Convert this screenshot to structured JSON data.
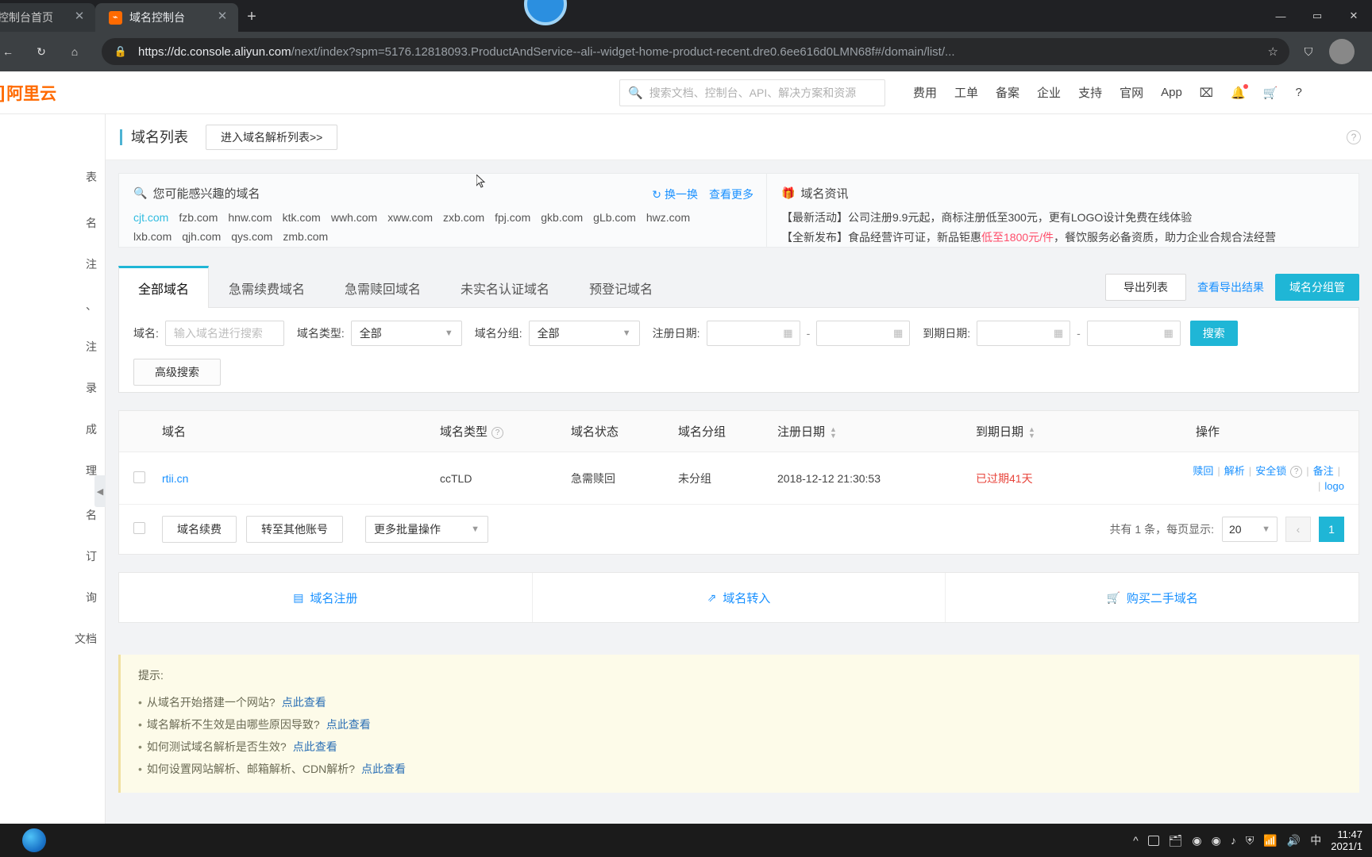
{
  "browser": {
    "tabs": [
      {
        "title": "云控制台首页",
        "favicon": "aliyun-icon",
        "active": false
      },
      {
        "title": "域名控制台",
        "favicon": "aliyun-icon",
        "active": true
      }
    ],
    "newtab_label": "+",
    "window_controls": [
      "—",
      "▭",
      "✕"
    ],
    "reload_icon": "↻",
    "home_icon": "⌂",
    "lock_icon": "🔒",
    "url_scheme": "https://",
    "url_host": "dc.console.aliyun.com",
    "url_path": "/next/index?spm=5176.12818093.ProductAndService--ali--widget-home-product-recent.dre0.6ee616d0LMN68f#/domain/list/...",
    "star_icon": "☆",
    "collections_icon": "⛉"
  },
  "aliyun_header": {
    "logo_text": "阿里云",
    "search_placeholder": "搜索文档、控制台、API、解决方案和资源",
    "nav": [
      "费用",
      "工单",
      "备案",
      "企业",
      "支持",
      "官网",
      "App"
    ],
    "icons": [
      "terminal-icon",
      "bell-icon",
      "cart-icon",
      "help-icon"
    ]
  },
  "left_rail": {
    "items": [
      "表",
      "名",
      "注",
      "、",
      "注",
      "录",
      "成",
      "理",
      "名",
      "订",
      "询",
      "文档"
    ]
  },
  "panel": {
    "title": "域名列表",
    "enter_resolution_button": "进入域名解析列表>>",
    "help_icon": "?"
  },
  "promo": {
    "suggest_title": "您可能感兴趣的域名",
    "suggest_icon": "search-sparkle-icon",
    "refresh_label": "换一换",
    "more_label": "查看更多",
    "domains_line1": [
      "cjt.com",
      "fzb.com",
      "hnw.com",
      "ktk.com",
      "wwh.com",
      "xww.com",
      "zxb.com",
      "fpj.com",
      "gkb.com",
      "gLb.com",
      "hwz.com"
    ],
    "domains_line2": [
      "lxb.com",
      "qjh.com",
      "qys.com",
      "zmb.com"
    ],
    "news_title": "域名资讯",
    "news_icon": "gift-icon",
    "news1_prefix": "【最新活动】公司注册9.9元起，商标注册低至300元，更有LOGO设计免费在线体验",
    "news2_a": "【全新发布】食品经营许可证，新品钜惠",
    "news2_hl": "低至1800元/件",
    "news2_b": "，餐饮服务必备资质，助力企业合规合法经营"
  },
  "tabs": [
    {
      "label": "全部域名",
      "active": true
    },
    {
      "label": "急需续费域名",
      "active": false
    },
    {
      "label": "急需赎回域名",
      "active": false
    },
    {
      "label": "未实名认证域名",
      "active": false
    },
    {
      "label": "预登记域名",
      "active": false
    }
  ],
  "tabs_right": {
    "export_button": "导出列表",
    "view_export_link": "查看导出结果",
    "group_button": "域名分组管"
  },
  "filters": {
    "domain_label": "域名:",
    "domain_placeholder": "输入域名进行搜索",
    "type_label": "域名类型:",
    "type_value": "全部",
    "group_label": "域名分组:",
    "group_value": "全部",
    "reg_date_label": "注册日期:",
    "reg_date_from": "",
    "reg_date_to": "",
    "exp_date_label": "到期日期:",
    "exp_date_from": "",
    "exp_date_to": "",
    "date_separator": "-",
    "calendar_icon": "📅",
    "search_button": "搜索",
    "advanced_button": "高级搜索"
  },
  "table": {
    "headers": {
      "domain": "域名",
      "type": "域名类型",
      "type_help": "?",
      "status": "域名状态",
      "group": "域名分组",
      "reg_date": "注册日期",
      "exp_date": "到期日期",
      "operations": "操作"
    },
    "rows": [
      {
        "domain": "rtii.cn",
        "type": "ccTLD",
        "status": "急需赎回",
        "group": "未分组",
        "reg_date": "2018-12-12 21:30:53",
        "exp_date": "已过期41天",
        "ops": [
          "赎回",
          "解析",
          "安全锁",
          "备注",
          "logo"
        ]
      }
    ]
  },
  "table_footer": {
    "renew_button": "域名续费",
    "transfer_button": "转至其他账号",
    "batch_select": "更多批量操作",
    "total_text": "共有 1 条，每页显示:",
    "page_size": "20",
    "prev_icon": "‹",
    "current_page": "1"
  },
  "quick_actions": [
    {
      "icon": "register-icon",
      "label": "域名注册"
    },
    {
      "icon": "transfer-icon",
      "label": "域名转入"
    },
    {
      "icon": "cart-icon",
      "label": "购买二手域名"
    }
  ],
  "tips": {
    "title": "提示:",
    "items": [
      {
        "text": "从域名开始搭建一个网站?",
        "link": "点此查看"
      },
      {
        "text": "域名解析不生效是由哪些原因导致?",
        "link": "点此查看"
      },
      {
        "text": "如何测试域名解析是否生效?",
        "link": "点此查看"
      },
      {
        "text": "如何设置网站解析、邮箱解析、CDN解析?",
        "link": "点此查看"
      }
    ]
  },
  "taskbar": {
    "time": "11:47",
    "date": "2021/1",
    "ime": "中",
    "chevron": "^",
    "tray_icons": [
      "task-view-icon",
      "folder-icon",
      "chrome-icon",
      "green-app-icon",
      "music-icon",
      "shield-icon",
      "wifi-icon",
      "volume-icon"
    ]
  },
  "colors": {
    "accent": "#1fb6d6",
    "link": "#1890ff",
    "danger": "#e8453c",
    "brand_orange": "#ff6a00",
    "highlight_pink": "#ff4d6a"
  }
}
